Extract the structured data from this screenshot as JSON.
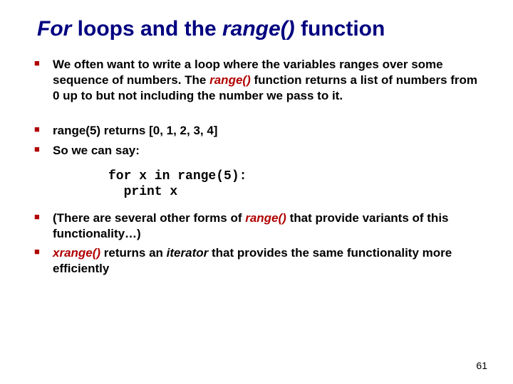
{
  "title": {
    "for_word": "For",
    "mid": " loops and the ",
    "range_word": "range()",
    "tail": " function"
  },
  "bullet1": {
    "pre": "We often want to write a loop where the variables ranges over some sequence of numbers.  The ",
    "range": "range()",
    "post": " function returns a list of numbers from 0 up to but not including the number we pass to it."
  },
  "bullet2": "range(5) returns [0, 1, 2, 3, 4]",
  "bullet3": "So we can say:",
  "code": "for x in range(5):\n  print x",
  "bullet4": {
    "pre": "(There are several other forms of ",
    "range": "range()",
    "post": " that provide variants of this functionality…)"
  },
  "bullet5": {
    "xrange": "xrange()",
    "mid": " returns an ",
    "iterator": "iterator",
    "post": " that provides the same functionality more efficiently"
  },
  "page_num": "61"
}
